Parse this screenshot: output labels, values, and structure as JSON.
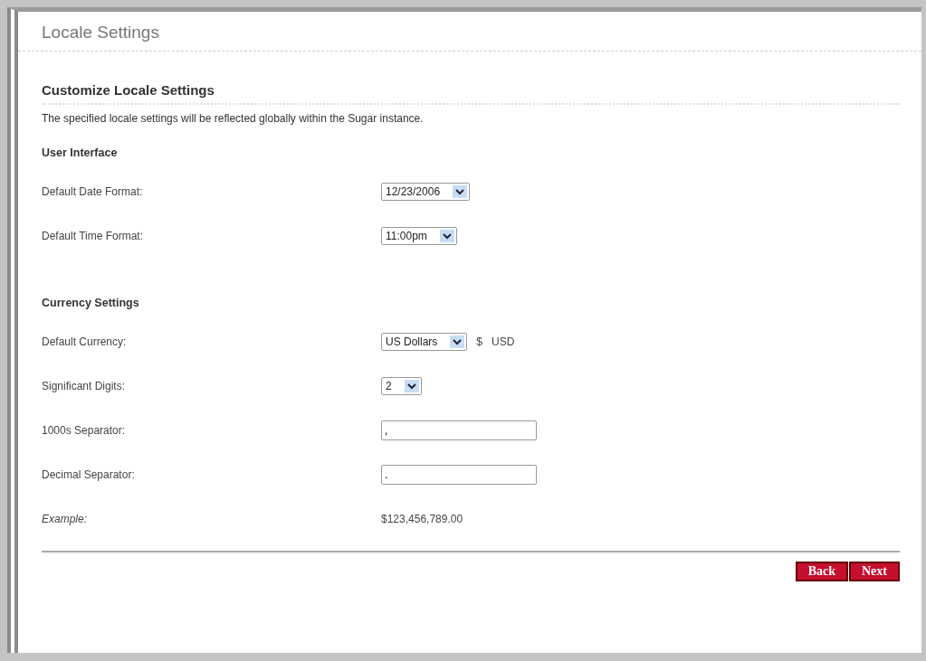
{
  "title": "Locale Settings",
  "section_title": "Customize Locale Settings",
  "description": "The specified locale settings will be reflected globally within the Sugar instance.",
  "groups": [
    {
      "heading": "User Interface",
      "rows": [
        {
          "kind": "select",
          "label": "Default Date Format:",
          "value": "12/23/2006"
        },
        {
          "kind": "select",
          "label": "Default Time Format:",
          "value": "11:00pm"
        }
      ]
    },
    {
      "heading": "Currency Settings",
      "rows": [
        {
          "kind": "select",
          "label": "Default Currency:",
          "value": "US Dollars",
          "extras": [
            "$",
            "USD"
          ]
        },
        {
          "kind": "select",
          "label": "Significant Digits:",
          "value": "2"
        },
        {
          "kind": "input",
          "label": "1000s Separator:",
          "value": ","
        },
        {
          "kind": "input",
          "label": "Decimal Separator:",
          "value": "."
        },
        {
          "kind": "example",
          "label": "Example:",
          "value": "$123,456,789.00"
        }
      ]
    }
  ],
  "buttons": [
    "Back",
    "Next"
  ]
}
